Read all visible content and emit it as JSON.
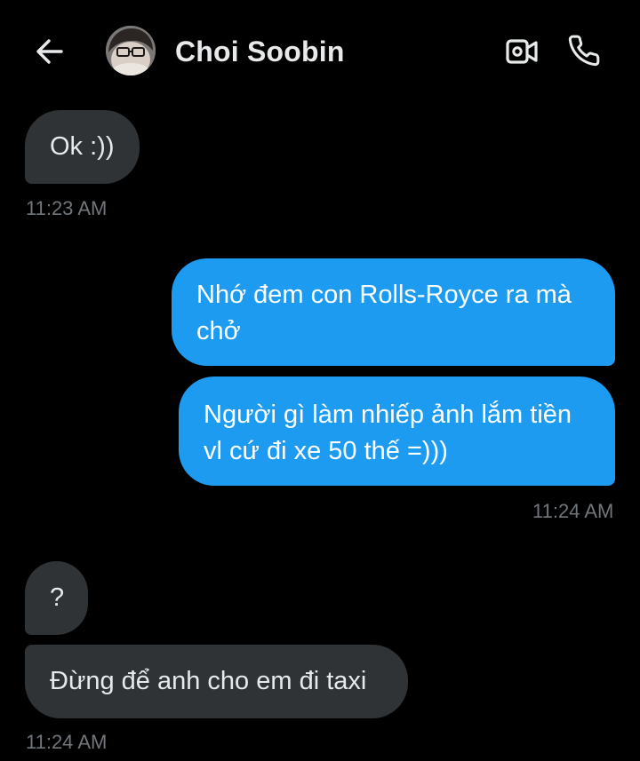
{
  "header": {
    "back_icon": "arrow-left-icon",
    "contact_name": "Choi Soobin",
    "video_icon": "video-camera-icon",
    "call_icon": "phone-icon"
  },
  "messages": [
    {
      "direction": "incoming",
      "text": "Ok :))"
    },
    {
      "direction": "outgoing",
      "text": "Nhớ đem con Rolls-Royce ra mà chở"
    },
    {
      "direction": "outgoing",
      "text": "Người gì làm nhiếp ảnh lắm tiền vl cứ đi xe 50 thế =)))"
    },
    {
      "direction": "incoming",
      "text": "?"
    },
    {
      "direction": "incoming",
      "text": "Đừng để anh cho em đi taxi"
    }
  ],
  "timestamps": [
    "11:23 AM",
    "11:24 AM",
    "11:24 AM"
  ],
  "colors": {
    "background": "#000000",
    "incoming_bubble": "#2f3336",
    "outgoing_bubble": "#1d9bf0",
    "timestamp": "#71767b"
  }
}
